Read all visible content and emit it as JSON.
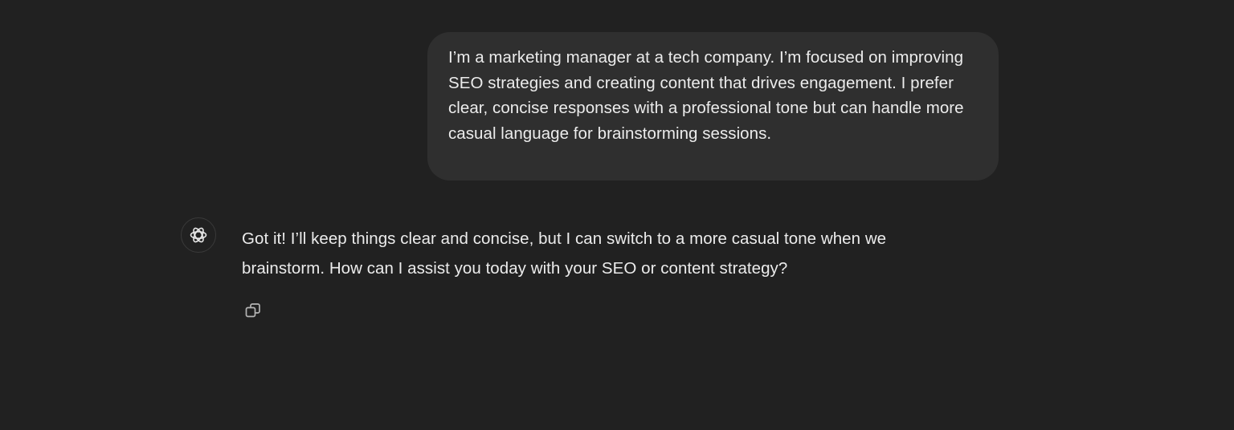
{
  "conversation": {
    "user_message": "I’m a marketing manager at a tech company. I’m focused on improving SEO strategies and creating content that drives engagement. I prefer clear, concise responses with a professional tone but can handle more casual language for brainstorming sessions.",
    "assistant_message": "Got it! I’ll keep things clear and concise, but I can switch to a more casual tone when we brainstorm. How can I assist you today with your SEO or content strategy?"
  },
  "icons": {
    "assistant_avatar": "openai-logo-icon",
    "copy": "copy-icon"
  },
  "colors": {
    "background": "#212121",
    "user_bubble": "#2f2f2f",
    "text": "#ececec",
    "icon": "#b4b4b4"
  }
}
